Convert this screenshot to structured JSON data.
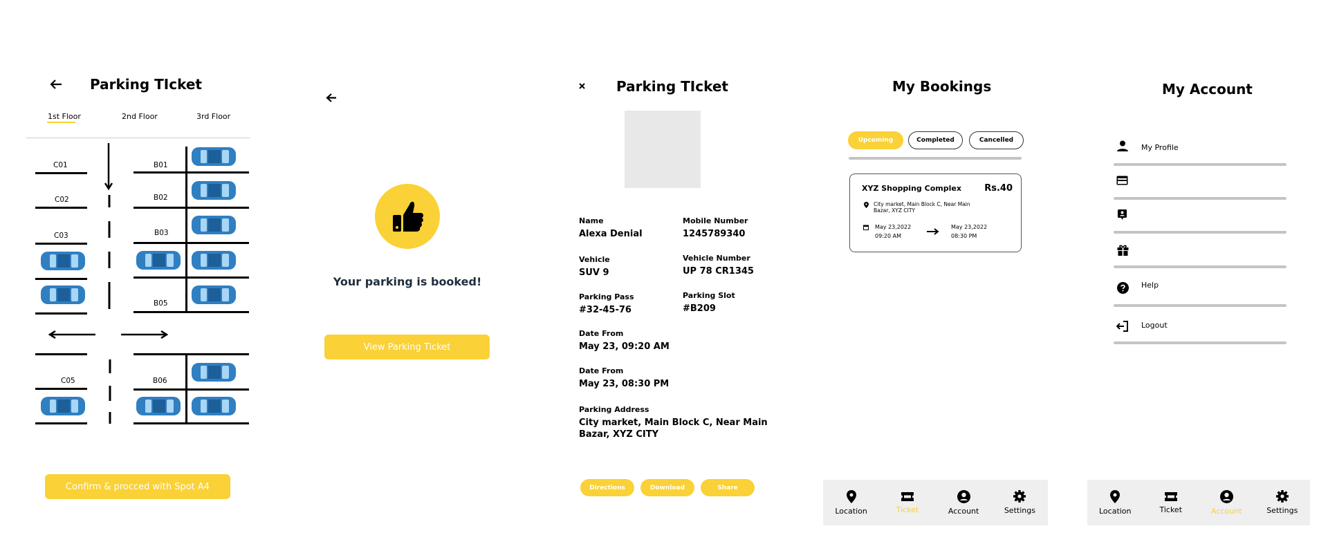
{
  "screen1": {
    "title": "Parking TIcket",
    "floors": [
      "1st Floor",
      "2nd Floor",
      "3rd Floor"
    ],
    "active_floor": "1st Floor",
    "spots": [
      "C01",
      "C02",
      "C03",
      "B01",
      "B02",
      "B03",
      "B05",
      "C05",
      "B06"
    ],
    "confirm_label": "Confirm & procced with Spot A4"
  },
  "screen2": {
    "message": "Your parking is booked!",
    "button_label": "View Parking Ticket"
  },
  "screen3": {
    "title": "Parking TIcket",
    "fields": {
      "name_label": "Name",
      "name": "Alexa Denial",
      "mobile_label": "Mobile Number",
      "mobile": "1245789340",
      "vehicle_label": "Vehicle",
      "vehicle": "SUV 9",
      "vehicle_number_label": "Vehicle Number",
      "vehicle_number": "UP 78 CR1345",
      "pass_label": "Parking Pass",
      "pass": "#32-45-76",
      "slot_label": "Parking Slot",
      "slot": "#B209",
      "date_from_label": "Date From",
      "date_from": "May 23, 09:20 AM",
      "date_to_label": "Date From",
      "date_to": "May 23, 08:30 PM",
      "address_label": "Parking Address",
      "address_line1": "City market, Main Block C, Near Main",
      "address_line2": "Bazar, XYZ CITY"
    },
    "buttons": [
      "Directions",
      "Download",
      "Share"
    ]
  },
  "screen4": {
    "title": "My Bookings",
    "tabs": [
      "Upcoming",
      "Completed",
      "Cancelled"
    ],
    "active_tab": "Upcoming",
    "booking": {
      "place": "XYZ Shopping Complex",
      "price": "Rs.40",
      "address_line1": "City market, Main Block C, Near Main",
      "address_line2": "Bazar, XYZ CITY",
      "from_date": "May 23,2022",
      "from_time": "09:20 AM",
      "to_date": "May 23,2022",
      "to_time": "08:30 PM"
    }
  },
  "screen5": {
    "title": "My Account",
    "items": [
      "My Profile",
      "",
      "",
      "",
      "Help",
      "Logout"
    ]
  },
  "nav": {
    "items": [
      "Location",
      "Ticket",
      "Account",
      "Settings"
    ]
  },
  "colors": {
    "accent": "#fad136",
    "car": "#2f7fc1",
    "grey": "#c4c4c4"
  }
}
